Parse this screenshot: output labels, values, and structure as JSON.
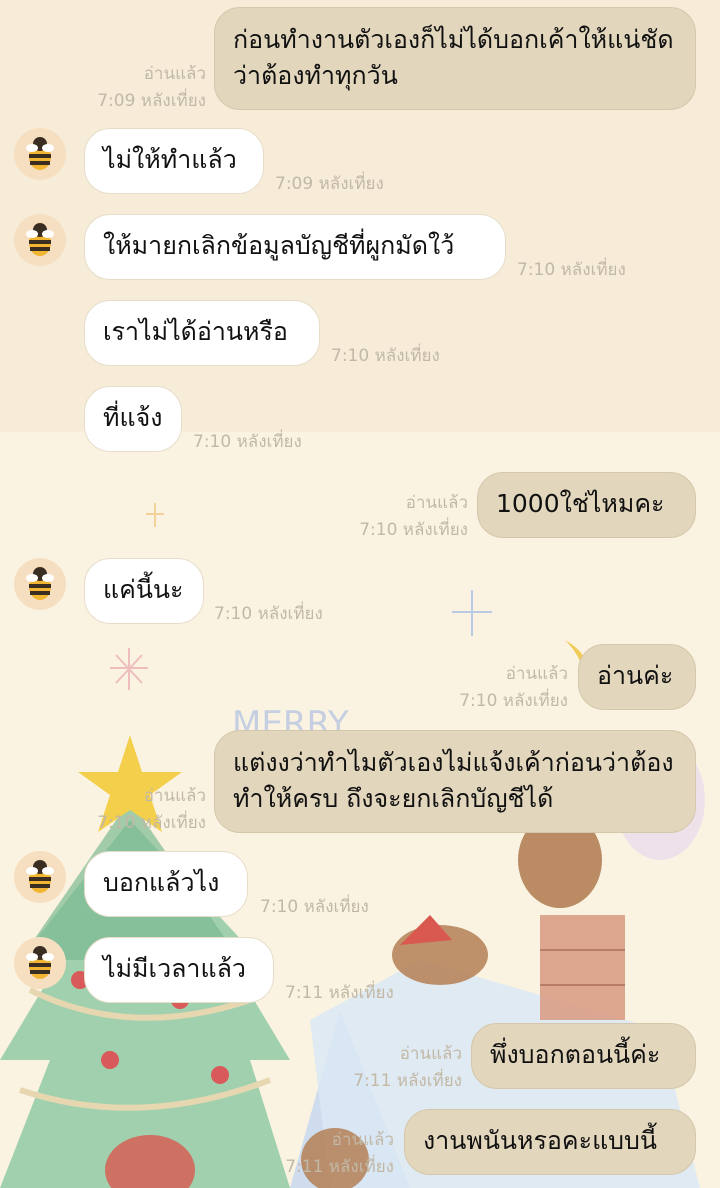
{
  "messages": [
    {
      "side": "out",
      "text": "ก่อนทำงานตัวเองก็ไม่ได้บอกเค้าให้แน่ชัดว่าต้องทำทุกวัน",
      "read": "อ่านแล้ว",
      "time": "7:09 หลังเที่ยง"
    },
    {
      "side": "in",
      "text": "ไม่ให้ทำแล้ว",
      "time": "7:09 หลังเที่ยง"
    },
    {
      "side": "in",
      "text": "ให้มายกเลิกข้อมูลบัญชีที่ผูกมัดใว้",
      "time": "7:10 หลังเที่ยง"
    },
    {
      "side": "in",
      "text": "เราไม่ได้อ่านหรือ",
      "time": "7:10 หลังเที่ยง"
    },
    {
      "side": "in",
      "text": "ที่แจ้ง",
      "time": "7:10 หลังเที่ยง"
    },
    {
      "side": "out",
      "text": "1000ใช่ไหมคะ",
      "read": "อ่านแล้ว",
      "time": "7:10 หลังเที่ยง"
    },
    {
      "side": "in",
      "text": "แค่นี้นะ",
      "time": "7:10 หลังเที่ยง"
    },
    {
      "side": "out",
      "text": "อ่านค่ะ",
      "read": "อ่านแล้ว",
      "time": "7:10 หลังเที่ยง"
    },
    {
      "side": "out",
      "text": "แต่งงว่าทำไมตัวเองไม่แจ้งเค้าก่อนว่าต้องทำให้ครบ ถึงจะยกเลิกบัญชีได้",
      "read": "อ่านแล้ว",
      "time": "7:10 หลังเที่ยง"
    },
    {
      "side": "in",
      "text": "บอกแล้วไง",
      "time": "7:10 หลังเที่ยง"
    },
    {
      "side": "in",
      "text": "ไม่มีเวลาแล้ว",
      "time": "7:11 หลังเที่ยง"
    },
    {
      "side": "out",
      "text": "พึ่งบอกตอนนี้ค่ะ",
      "read": "อ่านแล้ว",
      "time": "7:11 หลังเที่ยง"
    },
    {
      "side": "out",
      "text": "งานพนันหรอคะแบบนี้",
      "read": "อ่านแล้ว",
      "time": "7:11 หลังเที่ยง"
    }
  ],
  "background_words": [
    "MERRY"
  ],
  "colors": {
    "bubble_in": "#ffffff",
    "bubble_out": "#e2d6bd",
    "meta": "#c2b8a6",
    "background": "#fbf3e2"
  }
}
